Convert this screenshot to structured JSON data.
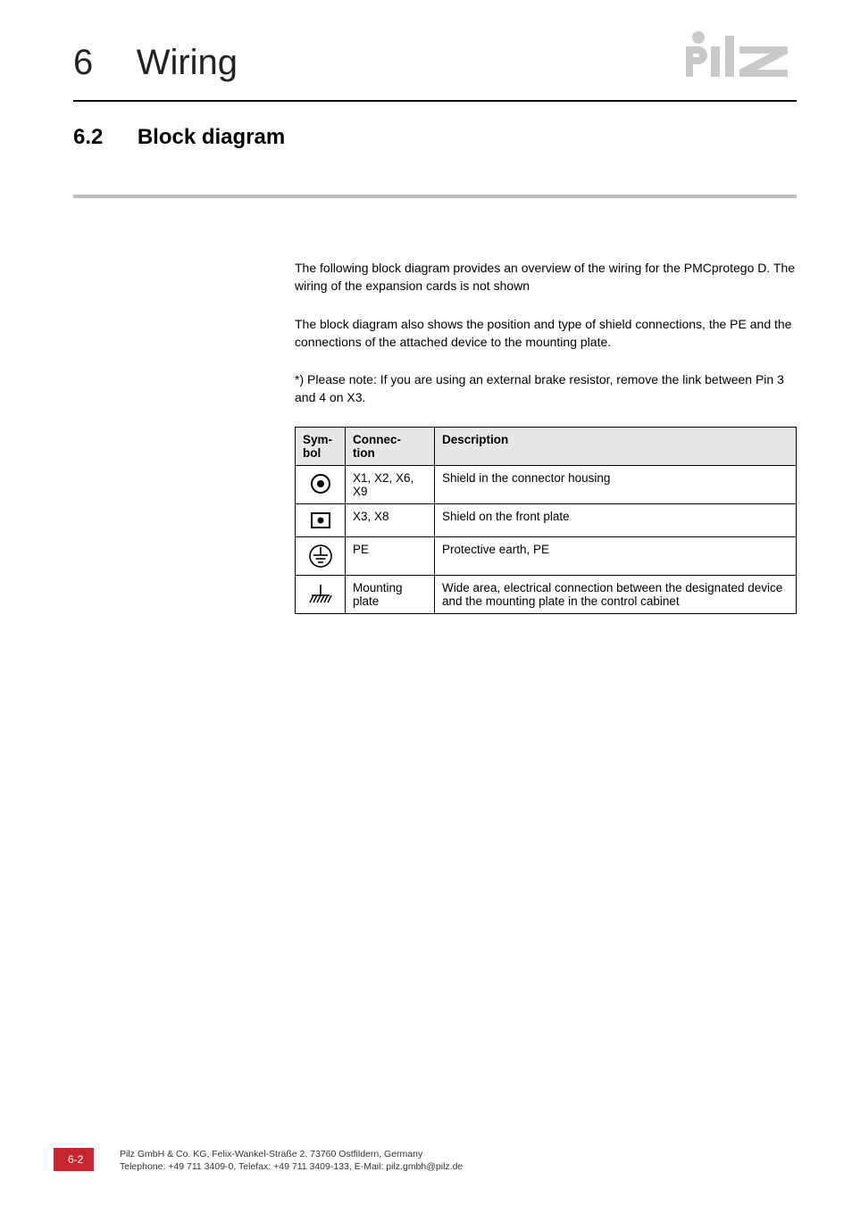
{
  "header": {
    "chapter_number": "6",
    "chapter_title": "Wiring",
    "logo_alt": "pilz"
  },
  "section": {
    "number": "6.2",
    "title": "Block diagram"
  },
  "paragraphs": {
    "p1": "The following block diagram provides an overview of the wiring for the PMCprotego D. The wiring of the expansion cards is not shown",
    "p2": "The block diagram also shows the position and type of shield connections, the PE and the connections of the attached device to the mounting plate.",
    "p3": "*) Please note: If you are using an external brake resistor, remove the link between Pin 3 and 4 on X3."
  },
  "table": {
    "headers": {
      "symbol": "Symbol",
      "connection": "Connection",
      "description": "Description"
    },
    "header_symbol_line1": "Sym-",
    "header_symbol_line2": "bol",
    "header_connection_line1": "Connec-",
    "header_connection_line2": "tion",
    "rows": [
      {
        "icon": "shield-connector-icon",
        "connection": "X1, X2, X6, X9",
        "description": "Shield in the connector housing"
      },
      {
        "icon": "shield-frontplate-icon",
        "connection": "X3, X8",
        "description": "Shield on the front plate"
      },
      {
        "icon": "protective-earth-icon",
        "connection": "PE",
        "description": "Protective earth, PE"
      },
      {
        "icon": "mounting-plate-icon",
        "connection": "Mounting plate",
        "description": "Wide area, electrical connection between the designated device and the mounting plate in the control cabinet"
      }
    ]
  },
  "footer": {
    "page_number": "6-2",
    "line1": "Pilz GmbH & Co. KG, Felix-Wankel-Straße 2, 73760 Ostfildern, Germany",
    "line2": "Telephone: +49 711 3409-0, Telefax: +49 711 3409-133, E-Mail: pilz.gmbh@pilz.de"
  }
}
